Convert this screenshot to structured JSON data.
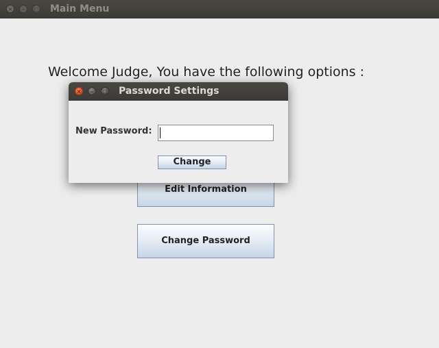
{
  "main_window": {
    "title": "Main Menu",
    "close_glyph": "×",
    "minimize_glyph": "–",
    "maximize_glyph": "□",
    "welcome_text": "Welcome Judge, You have the following options :",
    "buttons": {
      "edit_information": "Edit Information",
      "change_password": "Change Password"
    }
  },
  "dialog": {
    "title": "Password Settings",
    "close_glyph": "×",
    "minimize_glyph": "–",
    "maximize_glyph": "□",
    "new_password_label": "New Password:",
    "new_password_value": "",
    "change_button": "Change"
  },
  "icons": [
    "close-icon",
    "minimize-icon",
    "maximize-icon"
  ],
  "colors": {
    "titlebar": "#3c3b37",
    "window_bg": "#ededed",
    "button_border": "#7e93b0",
    "close_active": "#df4a16"
  }
}
